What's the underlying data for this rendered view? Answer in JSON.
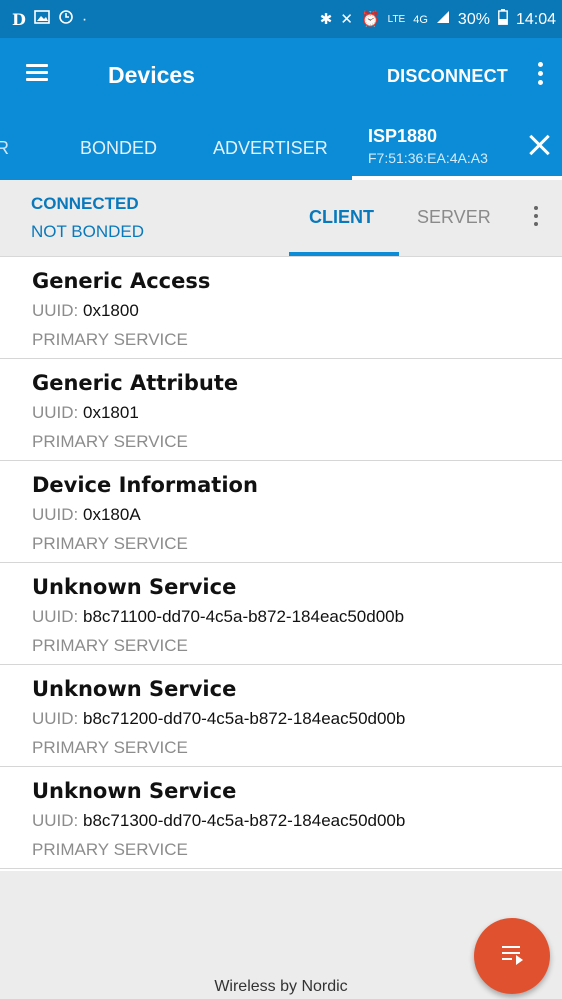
{
  "status_bar": {
    "left_icons": [
      "D",
      "image-icon",
      "clock-icon",
      "·"
    ],
    "battery": "30%",
    "time": "14:04",
    "network": "4G"
  },
  "app_bar": {
    "title": "Devices",
    "disconnect_label": "DISCONNECT"
  },
  "tabs": {
    "partial_label": "R",
    "bonded_label": "BONDED",
    "advertiser_label": "ADVERTISER",
    "device": {
      "name": "ISP1880",
      "address": "F7:51:36:EA:4A:A3"
    }
  },
  "connection": {
    "status": "CONNECTED",
    "bond_status": "NOT BONDED",
    "client_label": "CLIENT",
    "server_label": "SERVER"
  },
  "services": [
    {
      "name": "Generic Access",
      "uuid_label": "UUID:",
      "uuid": "0x1800",
      "type": "PRIMARY SERVICE"
    },
    {
      "name": "Generic Attribute",
      "uuid_label": "UUID:",
      "uuid": "0x1801",
      "type": "PRIMARY SERVICE"
    },
    {
      "name": "Device Information",
      "uuid_label": "UUID:",
      "uuid": "0x180A",
      "type": "PRIMARY SERVICE"
    },
    {
      "name": "Unknown Service",
      "uuid_label": "UUID:",
      "uuid": "b8c71100-dd70-4c5a-b872-184eac50d00b",
      "type": "PRIMARY SERVICE"
    },
    {
      "name": "Unknown Service",
      "uuid_label": "UUID:",
      "uuid": "b8c71200-dd70-4c5a-b872-184eac50d00b",
      "type": "PRIMARY SERVICE"
    },
    {
      "name": "Unknown Service",
      "uuid_label": "UUID:",
      "uuid": "b8c71300-dd70-4c5a-b872-184eac50d00b",
      "type": "PRIMARY SERVICE"
    }
  ],
  "footer": {
    "text": "Wireless by Nordic"
  },
  "colors": {
    "app_bar": "#0c8cd6",
    "status_bar": "#0a77b6",
    "accent_text": "#0a79bc",
    "fab": "#e0522f"
  }
}
